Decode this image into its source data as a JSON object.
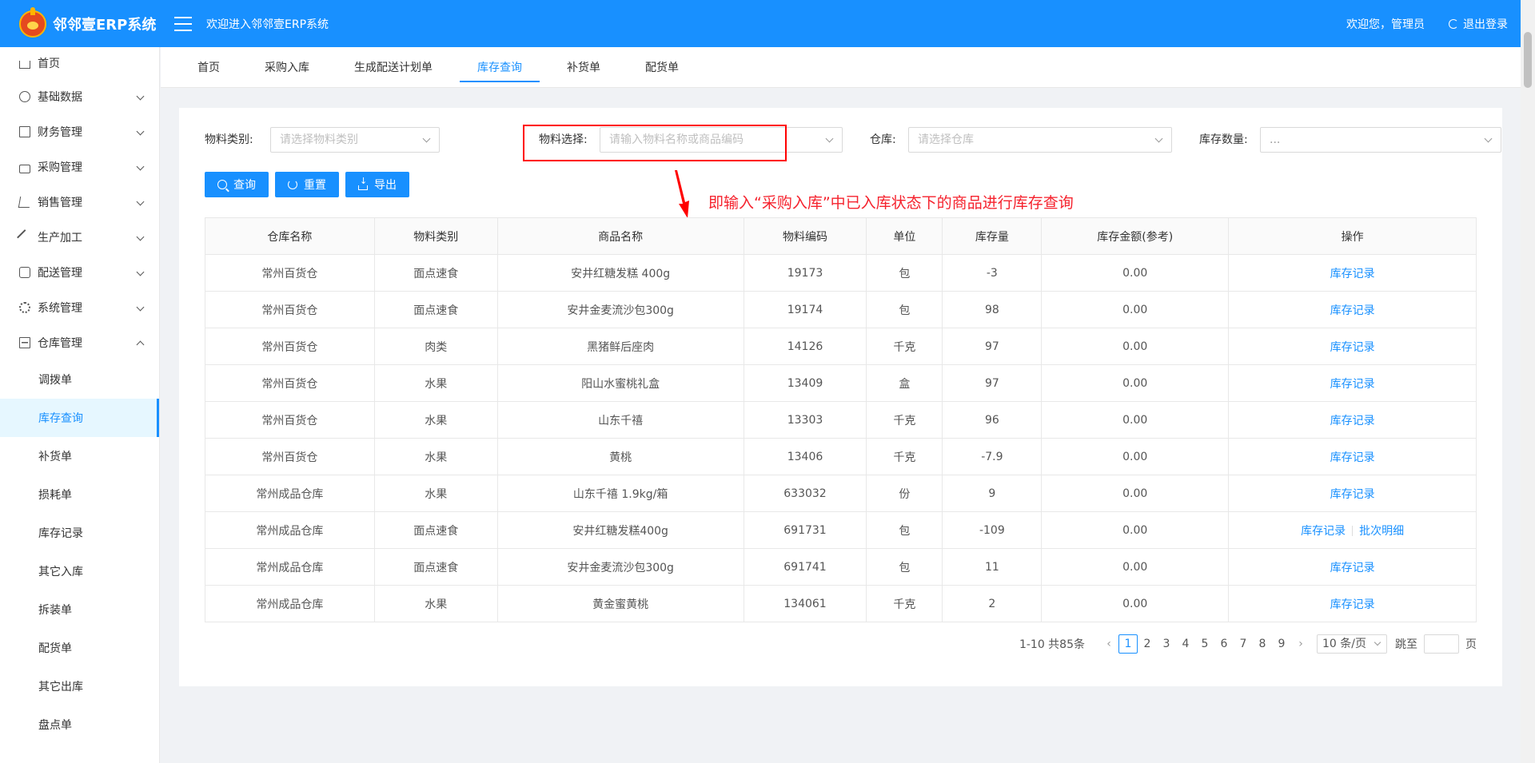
{
  "app": {
    "title": "邻邻壹ERP系统",
    "welcome": "欢迎进入邻邻壹ERP系统",
    "user_greeting": "欢迎您，管理员",
    "logout_label": "退出登录"
  },
  "sidebar": {
    "items": [
      {
        "label": "首页",
        "icon": "home-icon"
      },
      {
        "label": "基础数据",
        "icon": "pie-chart-icon"
      },
      {
        "label": "财务管理",
        "icon": "ledger-icon"
      },
      {
        "label": "采购管理",
        "icon": "shopping-bag-icon"
      },
      {
        "label": "销售管理",
        "icon": "cart-icon"
      },
      {
        "label": "生产加工",
        "icon": "tool-icon"
      },
      {
        "label": "配送管理",
        "icon": "truck-icon"
      },
      {
        "label": "系统管理",
        "icon": "gear-icon"
      },
      {
        "label": "仓库管理",
        "icon": "warehouse-icon"
      }
    ],
    "warehouse_children": [
      "调拨单",
      "库存查询",
      "补货单",
      "损耗单",
      "库存记录",
      "其它入库",
      "拆装单",
      "配货单",
      "其它出库",
      "盘点单"
    ],
    "active_child": "库存查询"
  },
  "tabs": [
    "首页",
    "采购入库",
    "生成配送计划单",
    "库存查询",
    "补货单",
    "配货单"
  ],
  "active_tab": "库存查询",
  "filters": {
    "category_label": "物料类别:",
    "category_placeholder": "请选择物料类别",
    "material_label": "物料选择:",
    "material_placeholder": "请输入物料名称或商品编码",
    "warehouse_label": "仓库:",
    "warehouse_placeholder": "请选择仓库",
    "qty_label": "库存数量:",
    "qty_placeholder": "..."
  },
  "buttons": {
    "search": "查询",
    "reset": "重置",
    "export": "导出"
  },
  "annotation": "即输入“采购入库”中已入库状态下的商品进行库存查询",
  "annotation_color": "#f5222d",
  "table": {
    "headers": [
      "仓库名称",
      "物料类别",
      "商品名称",
      "物料编码",
      "单位",
      "库存量",
      "库存金额(参考)",
      "操作"
    ],
    "rows": [
      [
        "常州百货仓",
        "面点速食",
        "安井红糖发糕 400g",
        "19173",
        "包",
        "-3",
        "0.00"
      ],
      [
        "常州百货仓",
        "面点速食",
        "安井金麦流沙包300g",
        "19174",
        "包",
        "98",
        "0.00"
      ],
      [
        "常州百货仓",
        "肉类",
        "黑猪鲜后座肉",
        "14126",
        "千克",
        "97",
        "0.00"
      ],
      [
        "常州百货仓",
        "水果",
        "阳山水蜜桃礼盒",
        "13409",
        "盒",
        "97",
        "0.00"
      ],
      [
        "常州百货仓",
        "水果",
        "山东千禧",
        "13303",
        "千克",
        "96",
        "0.00"
      ],
      [
        "常州百货仓",
        "水果",
        "黄桃",
        "13406",
        "千克",
        "-7.9",
        "0.00"
      ],
      [
        "常州成品仓库",
        "水果",
        "山东千禧 1.9kg/箱",
        "633032",
        "份",
        "9",
        "0.00"
      ],
      [
        "常州成品仓库",
        "面点速食",
        "安井红糖发糕400g",
        "691731",
        "包",
        "-109",
        "0.00"
      ],
      [
        "常州成品仓库",
        "面点速食",
        "安井金麦流沙包300g",
        "691741",
        "包",
        "11",
        "0.00"
      ],
      [
        "常州成品仓库",
        "水果",
        "黄金蜜黄桃",
        "134061",
        "千克",
        "2",
        "0.00"
      ]
    ],
    "action_record": "库存记录",
    "action_batch": "批次明细"
  },
  "pagination": {
    "total_text": "1-10 共85条",
    "pages": [
      "1",
      "2",
      "3",
      "4",
      "5",
      "6",
      "7",
      "8",
      "9"
    ],
    "current": "1",
    "page_size": "10 条/页",
    "jump_label": "跳至",
    "page_unit": "页"
  },
  "colors": {
    "primary": "#1890ff",
    "highlight_box": "#ff0000"
  }
}
